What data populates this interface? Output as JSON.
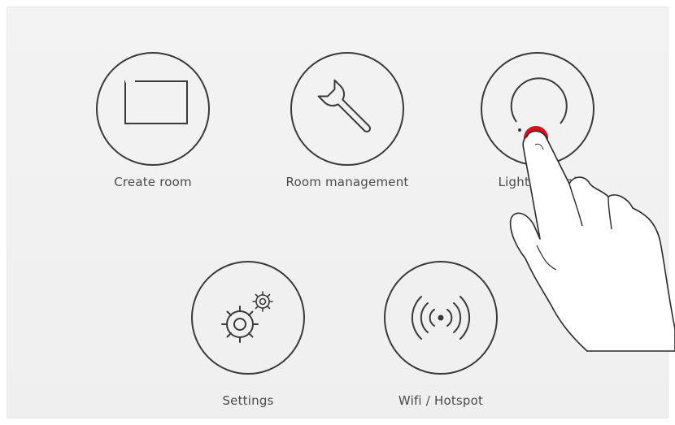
{
  "menu": {
    "items": [
      {
        "label": "Create room",
        "icon": "create-room-frame-icon"
      },
      {
        "label": "Room management",
        "icon": "wrench-icon"
      },
      {
        "label": "Light control",
        "icon": "dimmer-dial-icon"
      },
      {
        "label": "Settings",
        "icon": "gears-icon"
      },
      {
        "label": "Wifi / Hotspot",
        "icon": "wifi-hotspot-icon"
      }
    ]
  },
  "colors": {
    "background": "#f0f0f0",
    "outline": "#3a3a3a",
    "touch_indicator": "#d8101b"
  }
}
